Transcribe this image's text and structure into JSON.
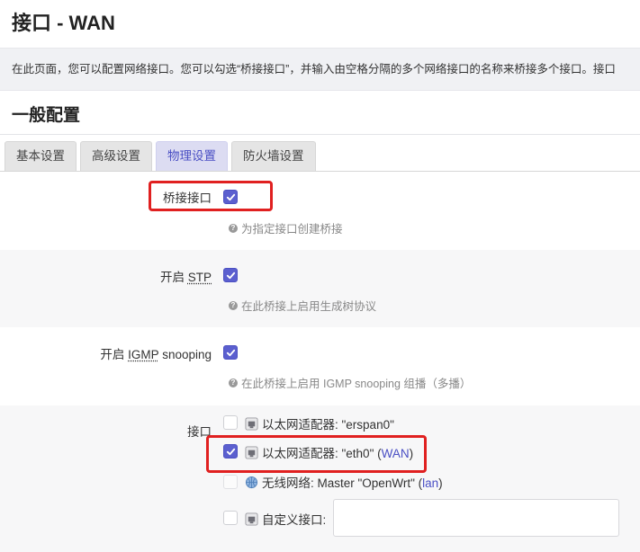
{
  "page": {
    "title": "接口 - WAN",
    "description": "在此页面，您可以配置网络接口。您可以勾选“桥接接口”，并输入由空格分隔的多个网络接口的名称来桥接多个接口。接口"
  },
  "section": {
    "title": "一般配置"
  },
  "tabs": [
    {
      "label": "基本设置",
      "active": false
    },
    {
      "label": "高级设置",
      "active": false
    },
    {
      "label": "物理设置",
      "active": true
    },
    {
      "label": "防火墙设置",
      "active": false
    }
  ],
  "fields": {
    "bridge": {
      "label": "桥接接口",
      "checked": true,
      "help": "为指定接口创建桥接"
    },
    "stp": {
      "label_prefix": "开启 ",
      "label_abbr": "STP",
      "checked": true,
      "help": "在此桥接上启用生成树协议"
    },
    "igmp": {
      "label_prefix": "开启 ",
      "label_abbr": "IGMP",
      "label_suffix": " snooping",
      "checked": true,
      "help": "在此桥接上启用 IGMP snooping 组播（多播）"
    },
    "ifaces": {
      "label": "接口",
      "items": [
        {
          "text": "以太网适配器: \"erspan0\"",
          "network": "",
          "checked": false,
          "icon": "ethernet-port-icon"
        },
        {
          "text": "以太网适配器: \"eth0\" (",
          "network": "WAN",
          "suffix": ")",
          "checked": true,
          "icon": "ethernet-port-icon"
        },
        {
          "text": "无线网络: Master \"OpenWrt\" (",
          "network": "lan",
          "suffix": ")",
          "checked": false,
          "icon": "wifi-globe-icon"
        },
        {
          "text": "自定义接口:",
          "network": "",
          "checked": false,
          "icon": "ethernet-port-icon"
        }
      ],
      "custom_value": ""
    }
  },
  "colors": {
    "accent": "#5b5fcf",
    "highlight": "#e02020",
    "active_tab_bg": "#dcdcf2"
  }
}
